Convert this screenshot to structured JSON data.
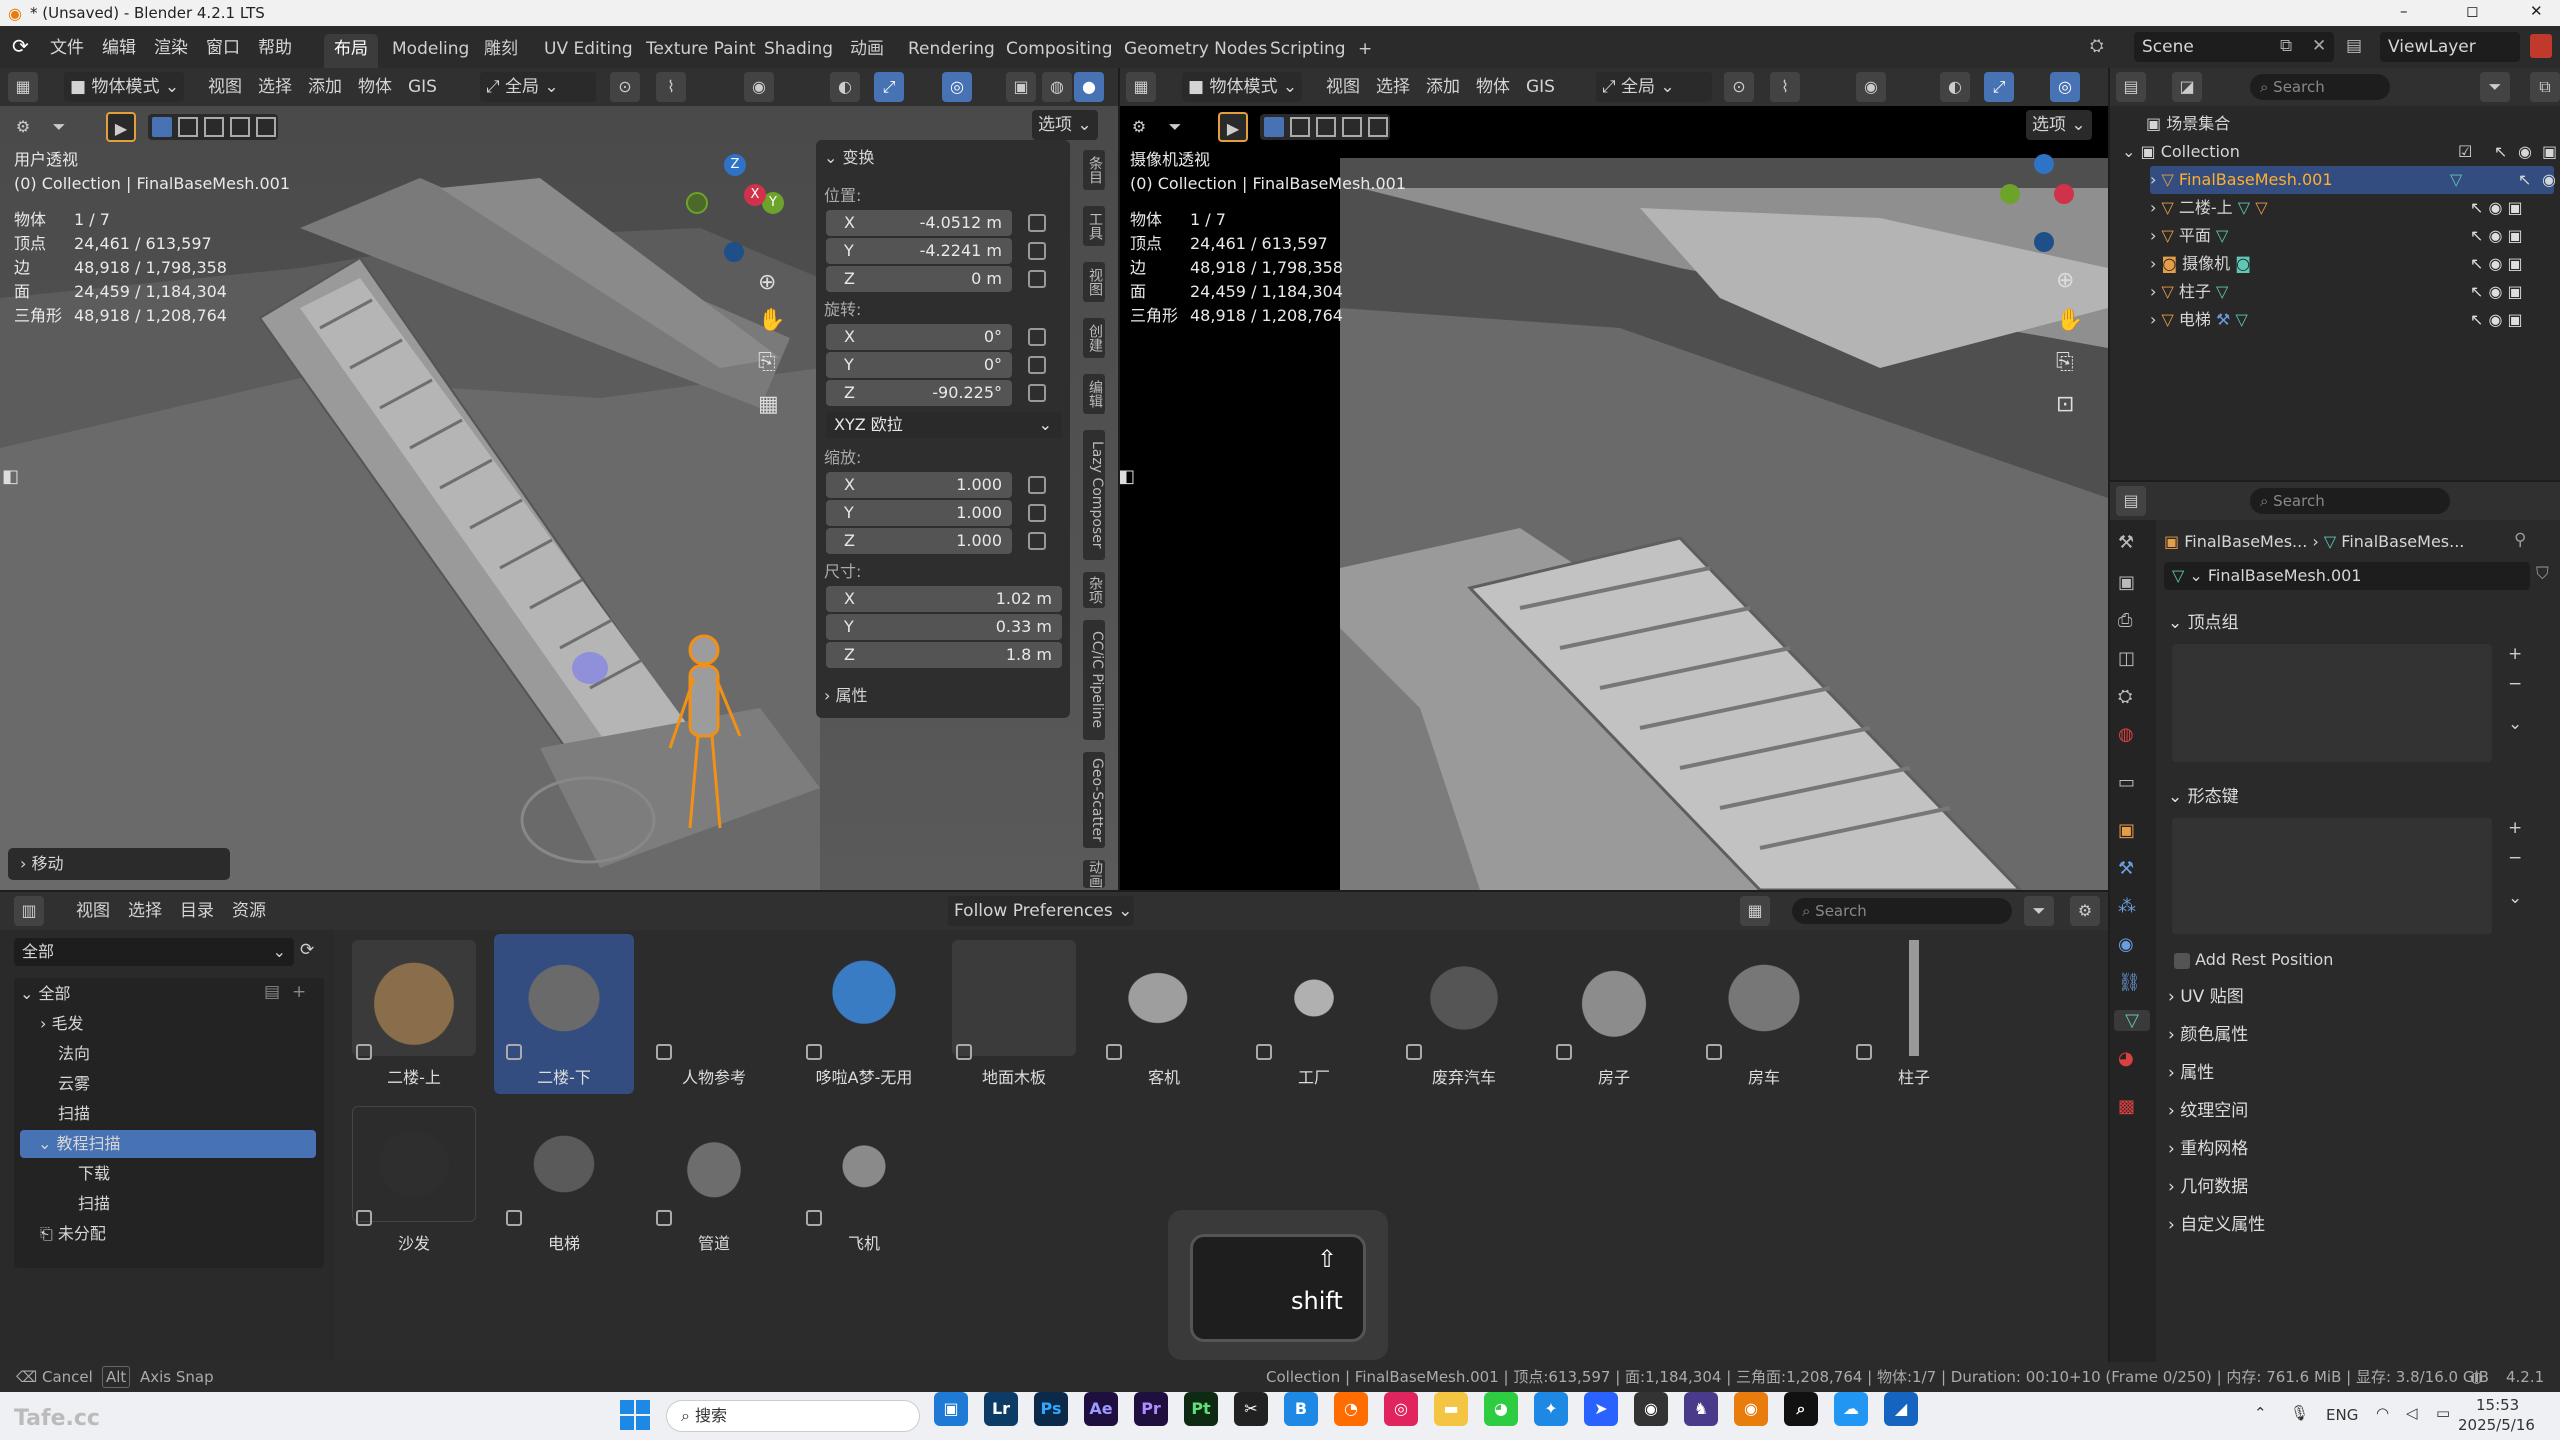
{
  "window": {
    "title": "* (Unsaved) - Blender 4.2.1 LTS",
    "minimize": "–",
    "maximize": "◻",
    "close": "✕"
  },
  "menu": {
    "items": [
      "文件",
      "编辑",
      "渲染",
      "窗口",
      "帮助"
    ],
    "workspaces": [
      "布局",
      "Modeling",
      "雕刻",
      "UV Editing",
      "Texture Paint",
      "Shading",
      "动画",
      "Rendering",
      "Compositing",
      "Geometry Nodes",
      "Scripting"
    ],
    "add_tab": "+",
    "scene": "Scene",
    "view_layer": "ViewLayer"
  },
  "viewport_left": {
    "mode": "物体模式",
    "menus": [
      "视图",
      "选择",
      "添加",
      "物体",
      "GIS"
    ],
    "orientation": "全局",
    "options": "选项",
    "overlay_title": "用户透视",
    "overlay_collection": "(0) Collection | FinalBaseMesh.001",
    "stats": [
      {
        "k": "物体",
        "v": "1 / 7"
      },
      {
        "k": "顶点",
        "v": "24,461 / 613,597"
      },
      {
        "k": "边",
        "v": "48,918 / 1,798,358"
      },
      {
        "k": "面",
        "v": "24,459 / 1,184,304"
      },
      {
        "k": "三角形",
        "v": "48,918 / 1,208,764"
      }
    ],
    "last_op": "移动",
    "gizmo": {
      "x": "X",
      "y": "Y",
      "z": "Z"
    }
  },
  "npanel": {
    "transform_title": "变换",
    "location_label": "位置:",
    "location": [
      {
        "axis": "X",
        "value": "-4.0512 m"
      },
      {
        "axis": "Y",
        "value": "-4.2241 m"
      },
      {
        "axis": "Z",
        "value": "0 m"
      }
    ],
    "rotation_label": "旋转:",
    "rotation": [
      {
        "axis": "X",
        "value": "0°"
      },
      {
        "axis": "Y",
        "value": "0°"
      },
      {
        "axis": "Z",
        "value": "-90.225°"
      }
    ],
    "rotation_mode": "XYZ 欧拉",
    "scale_label": "缩放:",
    "scale": [
      {
        "axis": "X",
        "value": "1.000"
      },
      {
        "axis": "Y",
        "value": "1.000"
      },
      {
        "axis": "Z",
        "value": "1.000"
      }
    ],
    "dimensions_label": "尺寸:",
    "dimensions": [
      {
        "axis": "X",
        "value": "1.02 m"
      },
      {
        "axis": "Y",
        "value": "0.33 m"
      },
      {
        "axis": "Z",
        "value": "1.8 m"
      }
    ],
    "properties": "属性",
    "tabs": [
      "条目",
      "工具",
      "视图",
      "创建",
      "编辑",
      "Lazy Composer",
      "杂项",
      "CC/iC Pipeline",
      "Geo-Scatter",
      "动画"
    ]
  },
  "viewport_right": {
    "mode": "物体模式",
    "menus": [
      "视图",
      "选择",
      "添加",
      "物体",
      "GIS"
    ],
    "orientation": "全局",
    "options": "选项",
    "overlay_title": "摄像机透视",
    "overlay_collection": "(0) Collection | FinalBaseMesh.001",
    "stats": [
      {
        "k": "物体",
        "v": "1 / 7"
      },
      {
        "k": "顶点",
        "v": "24,461 / 613,597"
      },
      {
        "k": "边",
        "v": "48,918 / 1,798,358"
      },
      {
        "k": "面",
        "v": "24,459 / 1,184,304"
      },
      {
        "k": "三角形",
        "v": "48,918 / 1,208,764"
      }
    ]
  },
  "outliner": {
    "search": "Search",
    "root": "场景集合",
    "collection": "Collection",
    "items": [
      {
        "name": "FinalBaseMesh.001",
        "selected": true
      },
      {
        "name": "二楼-上",
        "selected": false
      },
      {
        "name": "平面",
        "selected": false
      },
      {
        "name": "摄像机",
        "selected": false
      },
      {
        "name": "柱子",
        "selected": false
      },
      {
        "name": "电梯",
        "selected": false
      }
    ]
  },
  "properties": {
    "search": "Search",
    "breadcrumb_obj": "FinalBaseMes...",
    "breadcrumb_mesh": "FinalBaseMes...",
    "mesh_name": "FinalBaseMesh.001",
    "vertex_groups": "顶点组",
    "shape_keys": "形态键",
    "add_rest_position": "Add Rest Position",
    "sections": [
      "UV 贴图",
      "颜色属性",
      "属性",
      "纹理空间",
      "重构网格",
      "几何数据",
      "自定义属性"
    ]
  },
  "asset_browser": {
    "menus": [
      "视图",
      "选择",
      "目录",
      "资源"
    ],
    "library": "全部",
    "import_method": "Follow Preferences",
    "search": "Search",
    "catalog": [
      {
        "name": "全部",
        "level": 0
      },
      {
        "name": "毛发",
        "level": 1
      },
      {
        "name": "法向",
        "level": 1
      },
      {
        "name": "云雾",
        "level": 1
      },
      {
        "name": "扫描",
        "level": 1
      },
      {
        "name": "教程扫描",
        "level": 1
      },
      {
        "name": "下载",
        "level": 2
      },
      {
        "name": "扫描",
        "level": 2
      },
      {
        "name": "未分配",
        "level": 0
      }
    ],
    "assets": [
      "二楼-上",
      "二楼-下",
      "人物参考",
      "哆啦A梦-无用",
      "地面木板",
      "客机",
      "工厂",
      "废弃汽车",
      "房子",
      "房车",
      "柱子",
      "沙发",
      "电梯",
      "管道",
      "飞机"
    ]
  },
  "key_overlay": {
    "symbol": "⇧",
    "label": "shift"
  },
  "status": {
    "cancel_key": "⌫",
    "cancel": "Cancel",
    "snap_key": "Alt",
    "snap": "Axis Snap",
    "info": "Collection | FinalBaseMesh.001 | 顶点:613,597 | 面:1,184,304 | 三角面:1,208,764 | 物体:1/7 | Duration: 00:10+10 (Frame 0/250) | 内存: 761.6 MiB | 显存: 3.8/16.0 GiB",
    "version": "4.2.1"
  },
  "taskbar": {
    "search": "搜索",
    "lang": "ENG",
    "time": "15:53",
    "date": "2025/5/16",
    "watermark": "Tafe.cc"
  }
}
